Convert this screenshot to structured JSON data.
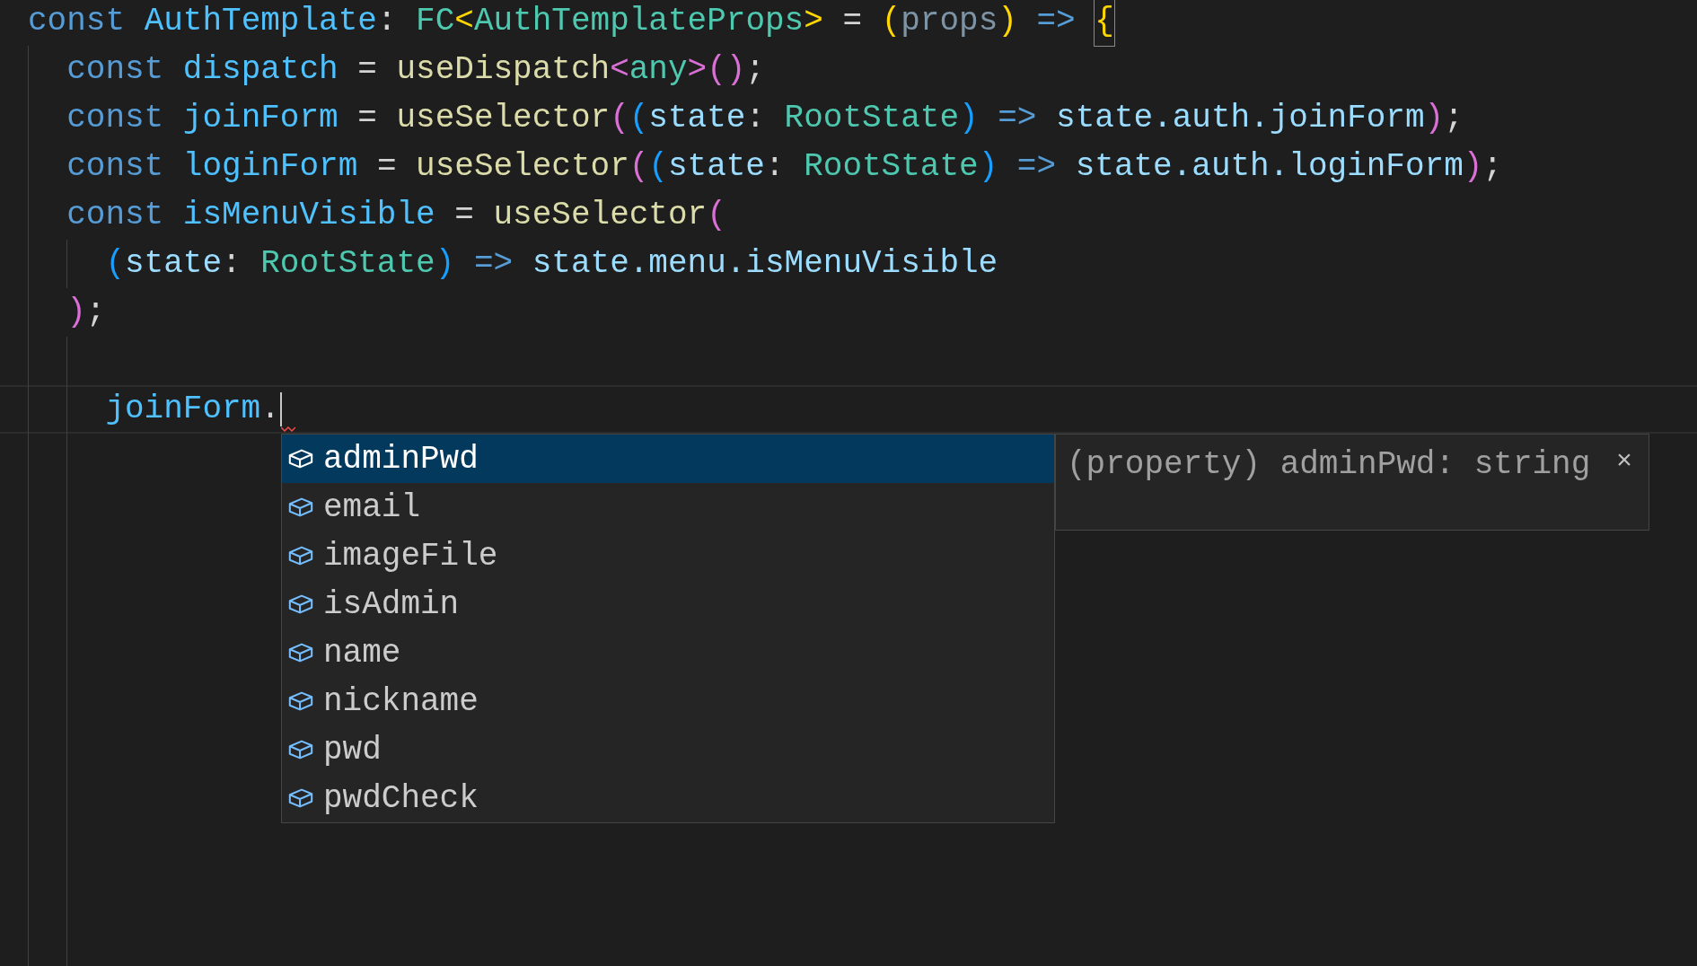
{
  "editor": {
    "lines": [
      {
        "active": false,
        "tokens": [
          {
            "kind": "keyword",
            "text": "const"
          },
          {
            "kind": "constant",
            "text": " AuthTemplate"
          },
          {
            "kind": "operator",
            "text": ":"
          },
          {
            "kind": "type",
            "text": " FC"
          },
          {
            "kind": "bracket-gold",
            "text": "<"
          },
          {
            "kind": "type",
            "text": "AuthTemplateProps"
          },
          {
            "kind": "bracket-gold",
            "text": ">"
          },
          {
            "kind": "operator",
            "text": " ="
          },
          {
            "kind": "bracket-gold",
            "text": " ("
          },
          {
            "kind": "unused",
            "text": "props"
          },
          {
            "kind": "bracket-gold",
            "text": ")"
          },
          {
            "kind": "keyword",
            "text": " =>"
          },
          {
            "kind": "bracket-match",
            "text": " {"
          }
        ],
        "children": [
          {
            "active": false,
            "tokens": [
              {
                "kind": "keyword",
                "text": "const"
              },
              {
                "kind": "constant",
                "text": " dispatch"
              },
              {
                "kind": "operator",
                "text": " ="
              },
              {
                "kind": "function",
                "text": " useDispatch"
              },
              {
                "kind": "bracket-purple",
                "text": "<"
              },
              {
                "kind": "type",
                "text": "any"
              },
              {
                "kind": "bracket-purple",
                "text": ">()"
              },
              {
                "kind": "operator",
                "text": ";"
              }
            ]
          },
          {
            "active": false,
            "tokens": [
              {
                "kind": "keyword",
                "text": "const"
              },
              {
                "kind": "constant",
                "text": " joinForm"
              },
              {
                "kind": "operator",
                "text": " ="
              },
              {
                "kind": "function",
                "text": " useSelector"
              },
              {
                "kind": "bracket-purple",
                "text": "("
              },
              {
                "kind": "bracket-blue",
                "text": "("
              },
              {
                "kind": "variable",
                "text": "state"
              },
              {
                "kind": "operator",
                "text": ":"
              },
              {
                "kind": "type",
                "text": " RootState"
              },
              {
                "kind": "bracket-blue",
                "text": ")"
              },
              {
                "kind": "keyword",
                "text": " =>"
              },
              {
                "kind": "variable",
                "text": " state.auth.joinForm"
              },
              {
                "kind": "bracket-purple",
                "text": ")"
              },
              {
                "kind": "operator",
                "text": ";"
              }
            ]
          },
          {
            "active": false,
            "tokens": [
              {
                "kind": "keyword",
                "text": "const"
              },
              {
                "kind": "constant",
                "text": " loginForm"
              },
              {
                "kind": "operator",
                "text": " ="
              },
              {
                "kind": "function",
                "text": " useSelector"
              },
              {
                "kind": "bracket-purple",
                "text": "("
              },
              {
                "kind": "bracket-blue",
                "text": "("
              },
              {
                "kind": "variable",
                "text": "state"
              },
              {
                "kind": "operator",
                "text": ":"
              },
              {
                "kind": "type",
                "text": " RootState"
              },
              {
                "kind": "bracket-blue",
                "text": ")"
              },
              {
                "kind": "keyword",
                "text": " =>"
              },
              {
                "kind": "variable",
                "text": " state.auth.loginForm"
              },
              {
                "kind": "bracket-purple",
                "text": ")"
              },
              {
                "kind": "operator",
                "text": ";"
              }
            ]
          },
          {
            "active": false,
            "tokens": [
              {
                "kind": "keyword",
                "text": "const"
              },
              {
                "kind": "constant",
                "text": " isMenuVisible"
              },
              {
                "kind": "operator",
                "text": " ="
              },
              {
                "kind": "function",
                "text": " useSelector"
              },
              {
                "kind": "bracket-purple",
                "text": "("
              }
            ],
            "children": [
              {
                "active": false,
                "tokens": [
                  {
                    "kind": "bracket-blue",
                    "text": "("
                  },
                  {
                    "kind": "variable",
                    "text": "state"
                  },
                  {
                    "kind": "operator",
                    "text": ":"
                  },
                  {
                    "kind": "type",
                    "text": " RootState"
                  },
                  {
                    "kind": "bracket-blue",
                    "text": ")"
                  },
                  {
                    "kind": "keyword",
                    "text": " =>"
                  },
                  {
                    "kind": "variable",
                    "text": " state.menu.isMenuVisible"
                  }
                ]
              }
            ]
          },
          {
            "active": false,
            "tokens": [
              {
                "kind": "bracket-purple",
                "text": ")"
              },
              {
                "kind": "operator",
                "text": ";"
              }
            ],
            "children": [
              {
                "active": false
              },
              {
                "active": true,
                "tokens": [
                  {
                    "kind": "constant",
                    "text": "joinForm"
                  },
                  {
                    "kind": "operator",
                    "text": "."
                  }
                ]
              }
            ]
          }
        ]
      }
    ]
  },
  "suggestions": {
    "items": [
      {
        "label": "adminPwd",
        "selected": true
      },
      {
        "label": "email",
        "selected": false
      },
      {
        "label": "imageFile",
        "selected": false
      },
      {
        "label": "isAdmin",
        "selected": false
      },
      {
        "label": "name",
        "selected": false
      },
      {
        "label": "nickname",
        "selected": false
      },
      {
        "label": "pwd",
        "selected": false
      },
      {
        "label": "pwdCheck",
        "selected": false
      }
    ],
    "detail": {
      "text": "(property) adminPwd: string",
      "close": "×"
    }
  }
}
